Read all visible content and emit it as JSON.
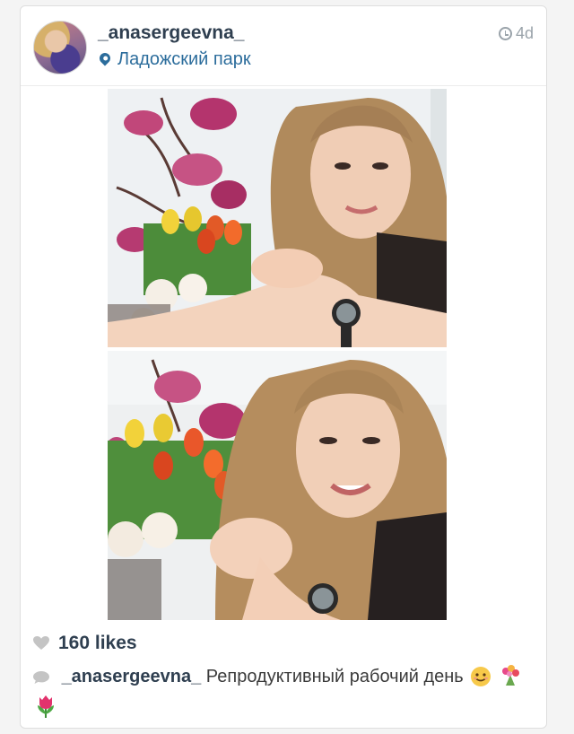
{
  "post": {
    "username": "_anasergeevna_",
    "location": "Ладожский парк",
    "time": "4d",
    "likes": "160 likes",
    "caption_user": "_anasergeevna_",
    "caption_text": "Репродуктивный рабочий день"
  },
  "icons": {
    "location": "location-pin-icon",
    "time": "clock-icon",
    "likes": "heart-icon",
    "comment": "comment-icon",
    "emoji": [
      "smiling-face-emoji",
      "bouquet-emoji",
      "tulip-emoji"
    ]
  },
  "colors": {
    "username": "#2f3f50",
    "location": "#2c6d9c",
    "muted": "#9aa3aa"
  }
}
